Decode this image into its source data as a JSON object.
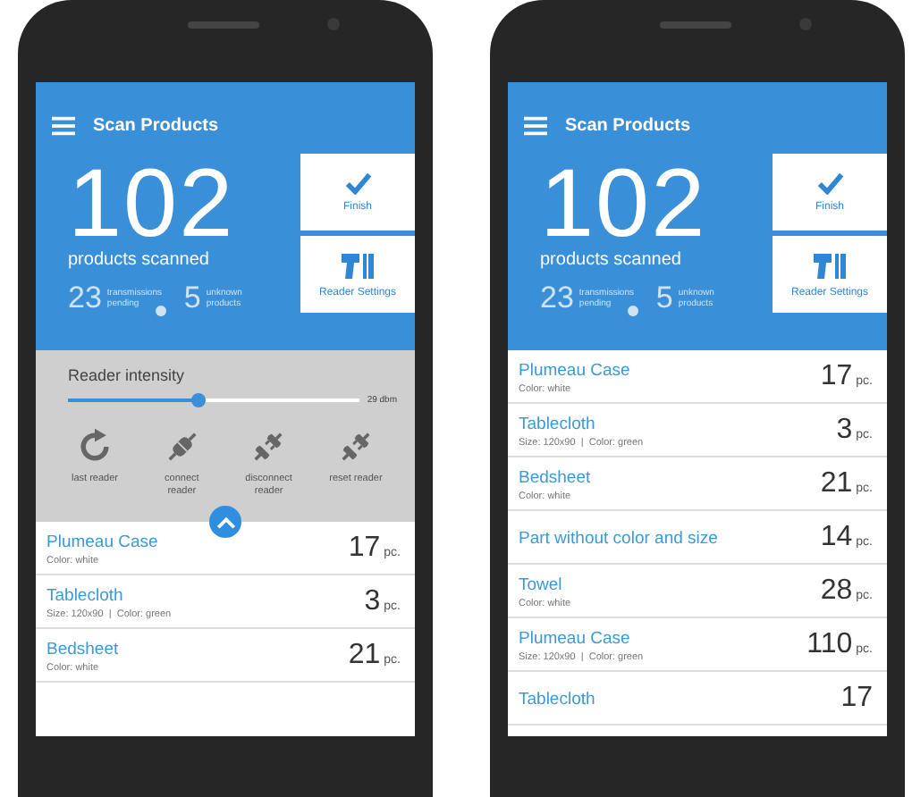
{
  "phones": [
    {
      "app_bar": {
        "title": "Scan Products"
      },
      "summary": {
        "count": "102",
        "label": "products scanned",
        "stats": [
          {
            "value": "23",
            "label": "transmissions pending",
            "badge": true
          },
          {
            "value": "5",
            "label": "unknown products",
            "badge": false
          }
        ]
      },
      "tiles": [
        {
          "kind": "finish",
          "label": "Finish"
        },
        {
          "kind": "settings",
          "label": "Reader Settings"
        }
      ],
      "reader_panel": {
        "title": "Reader intensity",
        "level": 0.45,
        "reading": "29 dbm",
        "actions": [
          {
            "kind": "refresh",
            "label": "last reader"
          },
          {
            "kind": "connect",
            "label": "connect reader"
          },
          {
            "kind": "disconnect",
            "label": "disconnect reader"
          },
          {
            "kind": "reset",
            "label": "reset reader"
          }
        ]
      },
      "products": [
        {
          "name": "Plumeau Case",
          "details": "Color: white",
          "quantity": "17",
          "unit": "pc."
        },
        {
          "name": "Tablecloth",
          "details": "Size: 120x90  |  Color: green",
          "quantity": "3",
          "unit": "pc."
        },
        {
          "name": "Bedsheet",
          "details": "Color: white",
          "quantity": "21",
          "unit": "pc."
        }
      ]
    },
    {
      "app_bar": {
        "title": "Scan Products"
      },
      "summary": {
        "count": "102",
        "label": "products scanned",
        "stats": [
          {
            "value": "23",
            "label": "transmissions pending",
            "badge": true
          },
          {
            "value": "5",
            "label": "unknown products",
            "badge": false
          }
        ]
      },
      "tiles": [
        {
          "kind": "finish",
          "label": "Finish"
        },
        {
          "kind": "settings",
          "label": "Reader Settings"
        }
      ],
      "products": [
        {
          "name": "Plumeau Case",
          "details": "Color: white",
          "quantity": "17",
          "unit": "pc."
        },
        {
          "name": "Tablecloth",
          "details": "Size: 120x90  |  Color: green",
          "quantity": "3",
          "unit": "pc."
        },
        {
          "name": "Bedsheet",
          "details": "Color: white",
          "quantity": "21",
          "unit": "pc."
        },
        {
          "name": "Part without color and size",
          "quantity": "14",
          "unit": "pc."
        },
        {
          "name": "Towel",
          "details": "Color: white",
          "quantity": "28",
          "unit": "pc."
        },
        {
          "name": "Plumeau Case",
          "details": "Size: 120x90  |  Color: green",
          "quantity": "110",
          "unit": "pc."
        },
        {
          "name": "Tablecloth",
          "quantity": "17"
        }
      ]
    }
  ]
}
